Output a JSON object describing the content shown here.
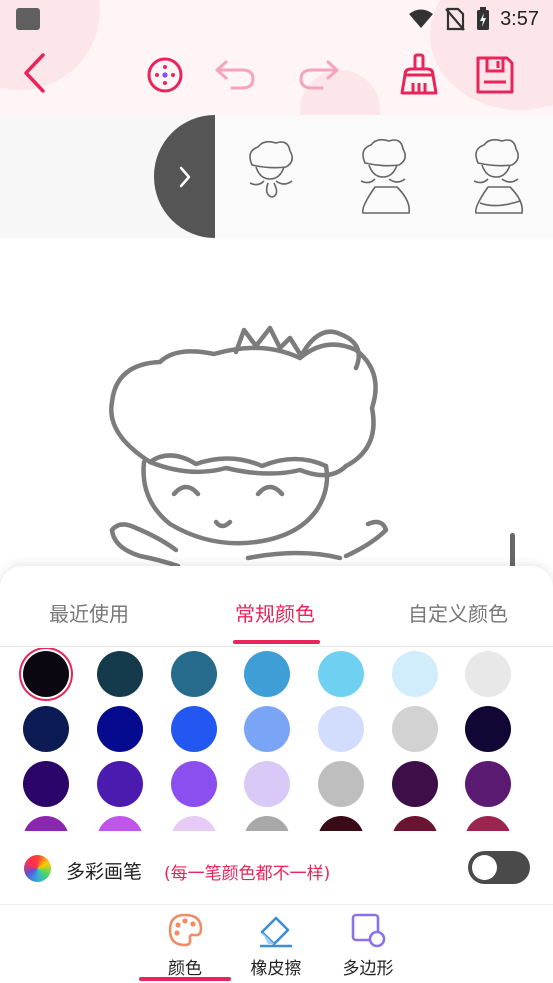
{
  "status_bar": {
    "time": "3:57"
  },
  "toolbar": {
    "back": "back-icon",
    "center": "crosshair-icon",
    "undo": "undo-icon",
    "redo": "redo-icon",
    "clear": "broom-icon",
    "save": "save-icon"
  },
  "thumbnails": {
    "toggle_icon": "chevron-right-icon",
    "count": 3
  },
  "tabs": [
    {
      "label": "最近使用",
      "active": false
    },
    {
      "label": "常规颜色",
      "active": true
    },
    {
      "label": "自定义颜色",
      "active": false
    }
  ],
  "colors": [
    [
      "#0b0710",
      "#143a4c",
      "#276b8c",
      "#3f9ed6",
      "#6fd0f2",
      "#d1ecfa",
      "#e8e8e8"
    ],
    [
      "#0c1b54",
      "#050a8e",
      "#2257f2",
      "#7aa5f6",
      "#d2dcfd",
      "#d2d2d2",
      "#110634"
    ],
    [
      "#2b0569",
      "#4b1aae",
      "#8b4fef",
      "#d9c9f7",
      "#bebebe",
      "#3d0e48",
      "#5a1a72"
    ],
    [
      "#8a26b0",
      "#c055ea",
      "#e6cbf7",
      "#a8a8a8",
      "#3a0a16",
      "#6a1432",
      "#9c2550"
    ]
  ],
  "selected_color": "#0b0710",
  "accent_color": "#e8245a",
  "rainbow": {
    "label": "多彩画笔",
    "note": "(每一笔颜色都不一样)",
    "enabled": false
  },
  "bottom_nav": [
    {
      "label": "颜色",
      "icon": "palette-icon",
      "active": true
    },
    {
      "label": "橡皮擦",
      "icon": "eraser-icon",
      "active": false
    },
    {
      "label": "多边形",
      "icon": "polygon-icon",
      "active": false
    }
  ]
}
